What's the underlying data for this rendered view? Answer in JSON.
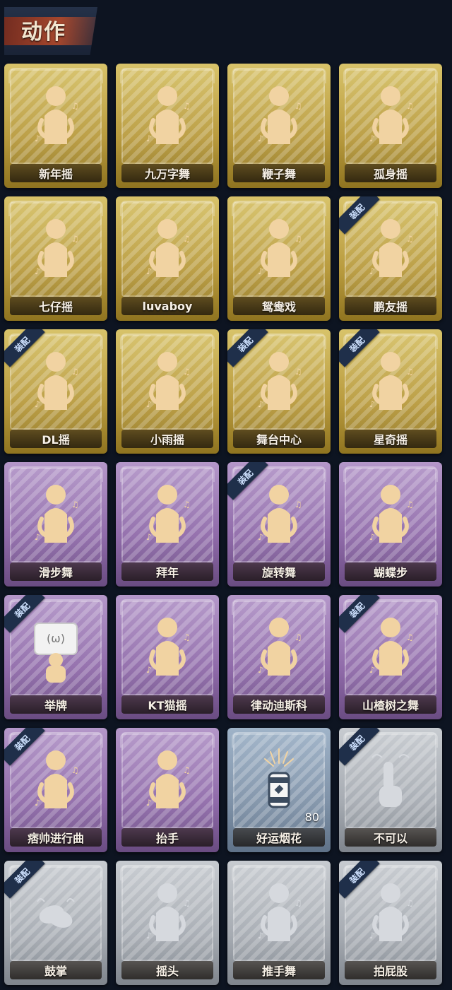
{
  "section": {
    "title": "动作"
  },
  "equip_label": "装配",
  "colors": {
    "gold": "#c9ad4f",
    "purple": "#8f6aa9",
    "blue": "#7f92a8",
    "gray": "#a6abb2",
    "icon": "#f1d3a2",
    "icon_gray": "#d6d9de"
  },
  "items": [
    {
      "label": "新年摇",
      "tier": "gold",
      "equipped": false,
      "icon": "dance-figure-icon"
    },
    {
      "label": "九万字舞",
      "tier": "gold",
      "equipped": false,
      "icon": "dance-figure-icon"
    },
    {
      "label": "鞭子舞",
      "tier": "gold",
      "equipped": false,
      "icon": "dance-figure-icon"
    },
    {
      "label": "孤身摇",
      "tier": "gold",
      "equipped": false,
      "icon": "dance-figure-icon"
    },
    {
      "label": "七仔摇",
      "tier": "gold",
      "equipped": false,
      "icon": "dance-figure-icon"
    },
    {
      "label": "luvaboy",
      "tier": "gold",
      "equipped": false,
      "icon": "dance-figure-icon"
    },
    {
      "label": "鸳鸯戏",
      "tier": "gold",
      "equipped": false,
      "icon": "dance-figure-icon"
    },
    {
      "label": "鹏友摇",
      "tier": "gold",
      "equipped": true,
      "icon": "dance-figure-icon"
    },
    {
      "label": "DL摇",
      "tier": "gold",
      "equipped": true,
      "icon": "dance-figure-icon"
    },
    {
      "label": "小雨摇",
      "tier": "gold",
      "equipped": false,
      "icon": "dance-figure-icon"
    },
    {
      "label": "舞台中心",
      "tier": "gold",
      "equipped": true,
      "icon": "dance-figure-icon"
    },
    {
      "label": "星奇摇",
      "tier": "gold",
      "equipped": true,
      "icon": "dance-figure-icon"
    },
    {
      "label": "滑步舞",
      "tier": "purple",
      "equipped": false,
      "icon": "dance-figure-icon"
    },
    {
      "label": "拜年",
      "tier": "purple",
      "equipped": false,
      "icon": "dance-figure-icon"
    },
    {
      "label": "旋转舞",
      "tier": "purple",
      "equipped": true,
      "icon": "dance-figure-icon"
    },
    {
      "label": "蝴蝶步",
      "tier": "purple",
      "equipped": false,
      "icon": "dance-figure-icon"
    },
    {
      "label": "举牌",
      "tier": "purple",
      "equipped": true,
      "icon": "sign-holder-icon"
    },
    {
      "label": "KT猫摇",
      "tier": "purple",
      "equipped": false,
      "icon": "dance-figure-icon"
    },
    {
      "label": "律动迪斯科",
      "tier": "purple",
      "equipped": false,
      "icon": "dance-figure-icon"
    },
    {
      "label": "山楂树之舞",
      "tier": "purple",
      "equipped": true,
      "icon": "dance-figure-icon"
    },
    {
      "label": "痞帅进行曲",
      "tier": "purple",
      "equipped": true,
      "icon": "dance-figure-icon"
    },
    {
      "label": "抬手",
      "tier": "purple",
      "equipped": false,
      "icon": "dance-figure-icon"
    },
    {
      "label": "好运烟花",
      "tier": "blue",
      "equipped": false,
      "icon": "firework-icon",
      "count": "80"
    },
    {
      "label": "不可以",
      "tier": "gray",
      "equipped": true,
      "icon": "finger-wag-icon"
    },
    {
      "label": "鼓掌",
      "tier": "gray",
      "equipped": true,
      "icon": "clapping-hands-icon"
    },
    {
      "label": "摇头",
      "tier": "gray",
      "equipped": false,
      "icon": "dance-figure-icon"
    },
    {
      "label": "推手舞",
      "tier": "gray",
      "equipped": false,
      "icon": "dance-figure-icon"
    },
    {
      "label": "拍屁股",
      "tier": "gray",
      "equipped": true,
      "icon": "dance-figure-icon"
    }
  ]
}
